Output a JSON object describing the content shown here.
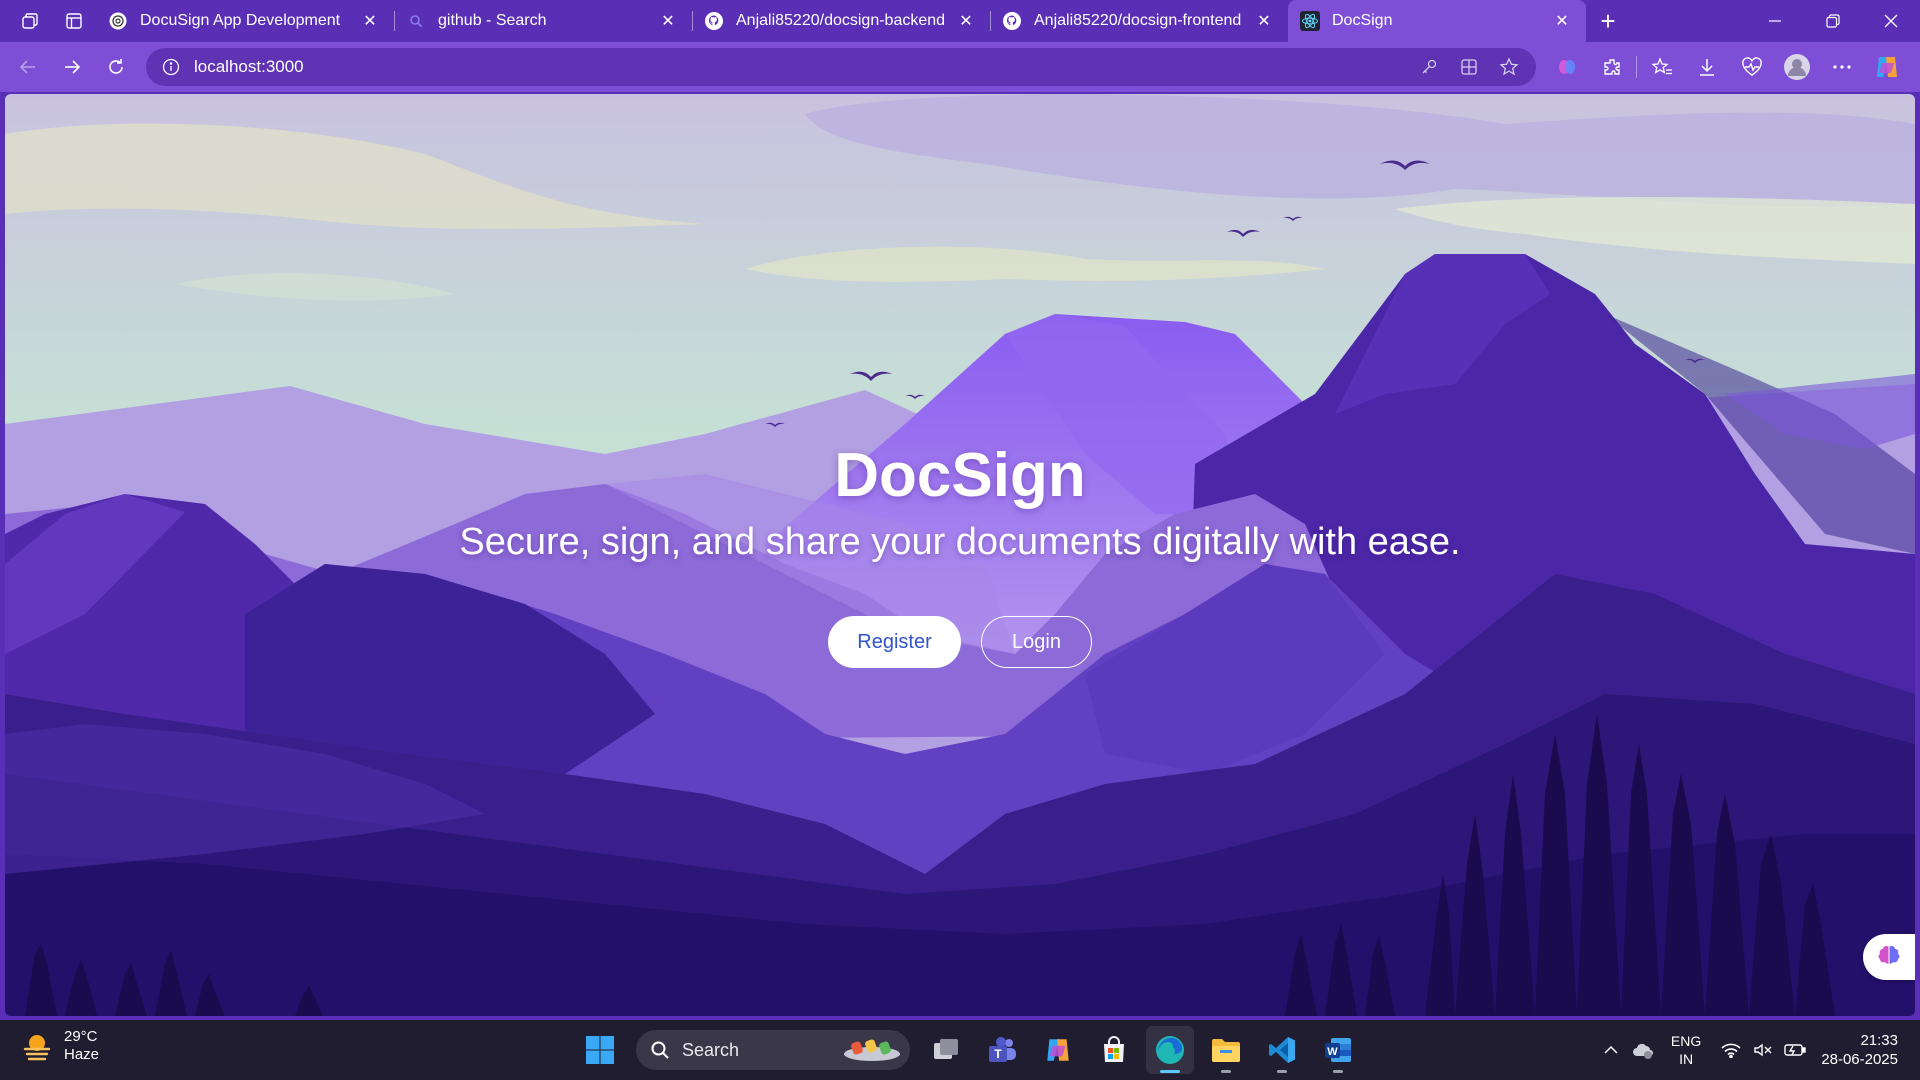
{
  "browser": {
    "tabs": [
      {
        "title": "DocuSign App Development",
        "favicon": "chatgpt-icon",
        "active": false
      },
      {
        "title": "github - Search",
        "favicon": "search-icon",
        "active": false
      },
      {
        "title": "Anjali85220/docsign-backend",
        "favicon": "github-icon",
        "active": false
      },
      {
        "title": "Anjali85220/docsign-frontend",
        "favicon": "github-icon",
        "active": false
      },
      {
        "title": "DocSign",
        "favicon": "react-icon",
        "active": true
      }
    ],
    "address": "localhost:3000",
    "accent_color": "#7e4fd6"
  },
  "page": {
    "title": "DocSign",
    "subtitle": "Secure, sign, and share your documents digitally with ease.",
    "register_label": "Register",
    "login_label": "Login"
  },
  "taskbar": {
    "weather": {
      "temp": "29°C",
      "condition": "Haze"
    },
    "search_label": "Search",
    "lang_line1": "ENG",
    "lang_line2": "IN",
    "time": "21:33",
    "date": "28-06-2025"
  }
}
